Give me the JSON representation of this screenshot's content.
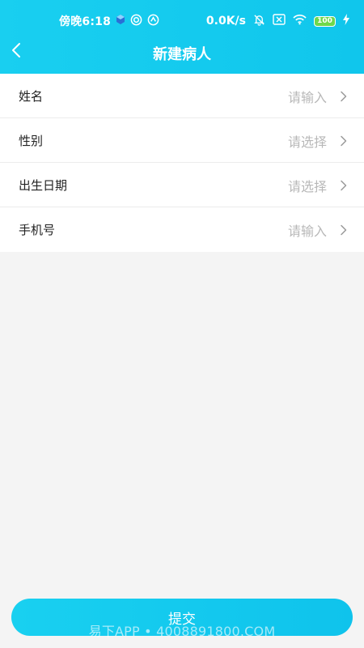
{
  "status_bar": {
    "time": "傍晚6:18",
    "network_speed": "0.0K/s",
    "battery_level": "100"
  },
  "header": {
    "title": "新建病人",
    "background": "#12c9ee"
  },
  "form": {
    "rows": [
      {
        "label": "姓名",
        "placeholder": "请输入"
      },
      {
        "label": "性别",
        "placeholder": "请选择"
      },
      {
        "label": "出生日期",
        "placeholder": "请选择"
      },
      {
        "label": "手机号",
        "placeholder": "请输入"
      }
    ]
  },
  "submit": {
    "label": "提交"
  },
  "watermark": "易下APP • 4008891800.COM",
  "colors": {
    "accent": "#12c9ee",
    "placeholder": "#b8b8b8",
    "page_bg": "#f4f4f4",
    "battery": "#6fd84c"
  }
}
